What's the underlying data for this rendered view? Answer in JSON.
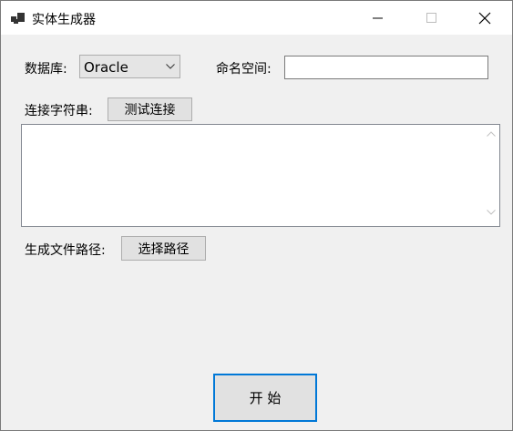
{
  "window": {
    "title": "实体生成器",
    "icon": "app-windows-icon"
  },
  "form": {
    "database_label": "数据库:",
    "database_value": "Oracle",
    "namespace_label": "命名空间:",
    "namespace_value": "",
    "connection_label": "连接字符串:",
    "test_button": "测试连接",
    "connection_value": "",
    "output_path_label": "生成文件路径:",
    "select_path_button": "选择路径",
    "start_button": "开 始"
  },
  "colors": {
    "accent": "#0078d7",
    "window_bg": "#f0f0f0",
    "titlebar_bg": "#ffffff"
  }
}
